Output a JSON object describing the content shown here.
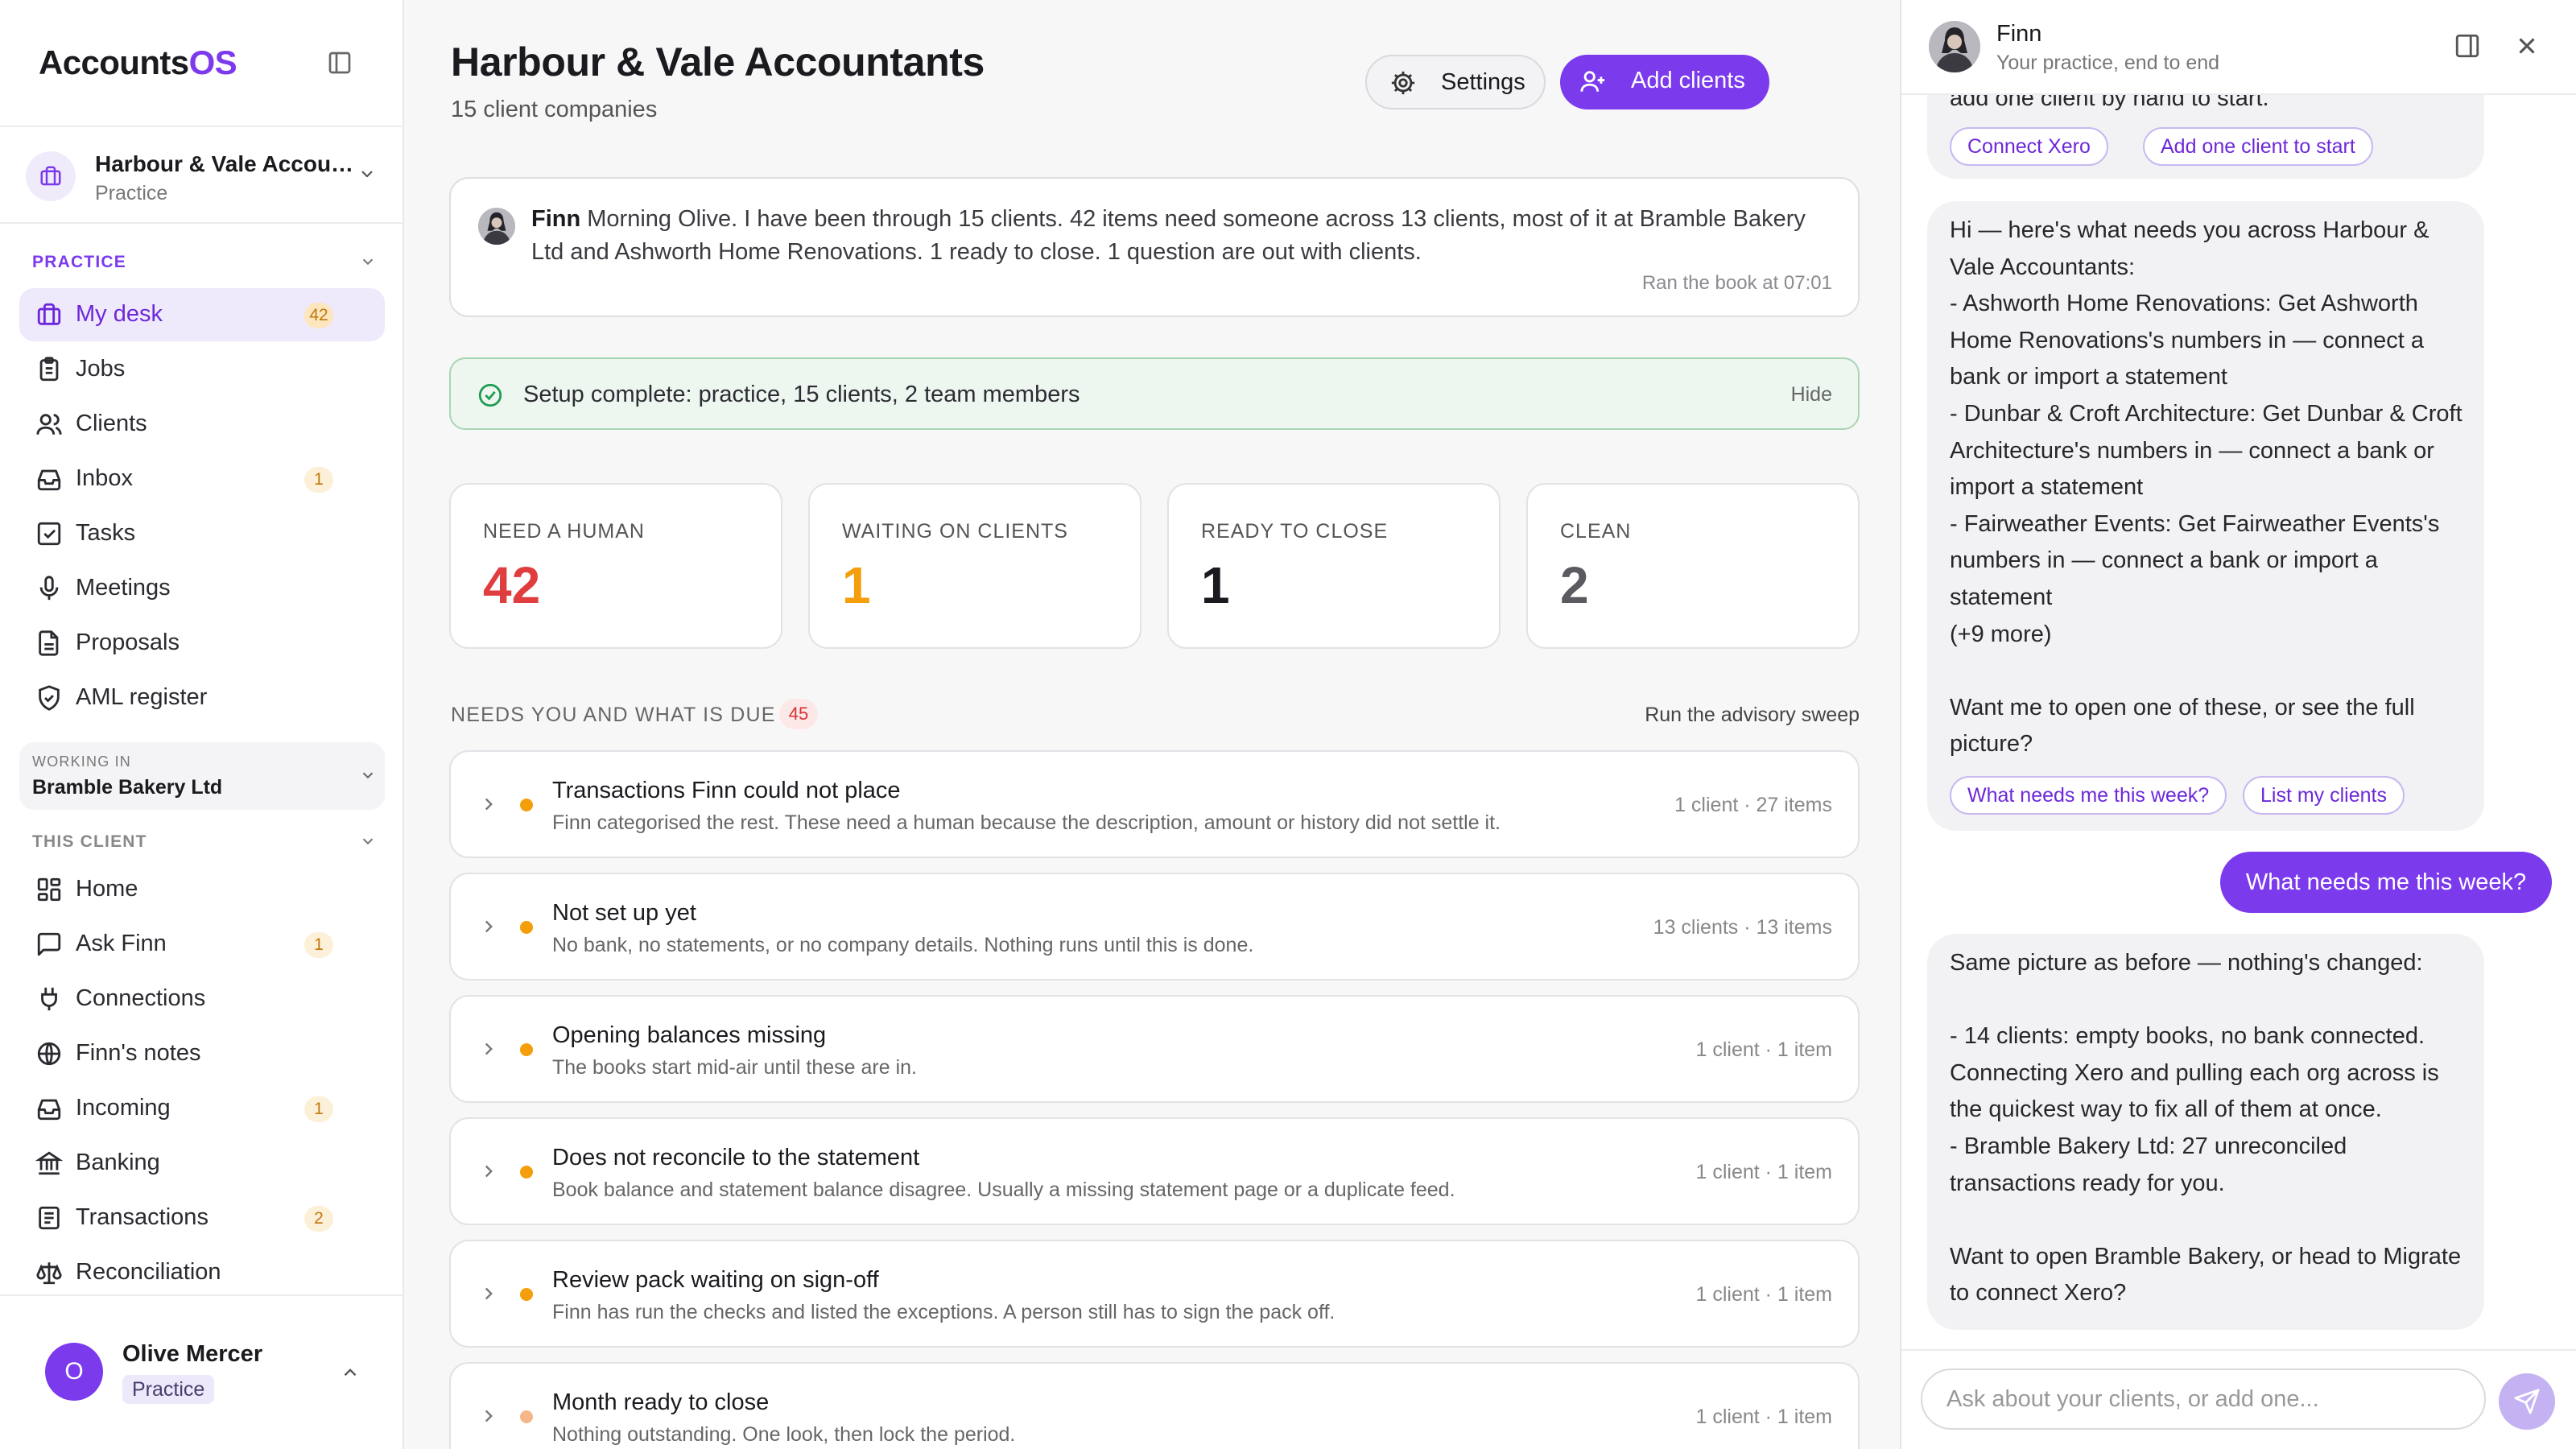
{
  "app": {
    "brand_prefix": "Accounts",
    "brand_suffix": "OS",
    "accent": "#7c3aed"
  },
  "org": {
    "name": "Harbour & Vale Accountants",
    "type": "Practice"
  },
  "sidebar": {
    "practice_label": "PRACTICE",
    "practice_items": [
      {
        "label": "My desk",
        "icon": "briefcase-icon",
        "badge": "42",
        "active": true
      },
      {
        "label": "Jobs",
        "icon": "clipboard-icon",
        "badge": ""
      },
      {
        "label": "Clients",
        "icon": "users-icon",
        "badge": ""
      },
      {
        "label": "Inbox",
        "icon": "inbox-icon",
        "badge": "1"
      },
      {
        "label": "Tasks",
        "icon": "checkbox-icon",
        "badge": ""
      },
      {
        "label": "Meetings",
        "icon": "microphone-icon",
        "badge": ""
      },
      {
        "label": "Proposals",
        "icon": "document-icon",
        "badge": ""
      },
      {
        "label": "AML register",
        "icon": "shield-check-icon",
        "badge": ""
      }
    ],
    "working_in_label": "WORKING IN",
    "working_in_value": "Bramble Bakery Ltd",
    "client_label": "THIS CLIENT",
    "client_items": [
      {
        "label": "Home",
        "icon": "grid-icon",
        "badge": ""
      },
      {
        "label": "Ask Finn",
        "icon": "chat-icon",
        "badge": "1"
      },
      {
        "label": "Connections",
        "icon": "plug-icon",
        "badge": ""
      },
      {
        "label": "Finn's notes",
        "icon": "globe-icon",
        "badge": ""
      },
      {
        "label": "Incoming",
        "icon": "inbox-icon",
        "badge": "1"
      },
      {
        "label": "Banking",
        "icon": "bank-icon",
        "badge": ""
      },
      {
        "label": "Transactions",
        "icon": "list-icon",
        "badge": "2"
      },
      {
        "label": "Reconciliation",
        "icon": "scale-icon",
        "badge": ""
      }
    ]
  },
  "user": {
    "initial": "O",
    "name": "Olive Mercer",
    "role": "Practice"
  },
  "header": {
    "title": "Harbour & Vale Accountants",
    "subtitle": "15 client companies",
    "settings_label": "Settings",
    "add_clients_label": "Add clients"
  },
  "briefing": {
    "author": "Finn",
    "text": "Morning Olive. I have been through 15 clients. 42 items need someone across 13 clients, most of it at Bramble Bakery Ltd and Ashworth Home Renovations. 1 ready to close. 1 question are out with clients.",
    "timestamp": "Ran the book at 07:01"
  },
  "setup": {
    "text": "Setup complete: practice, 15 clients, 2 team members",
    "hide_label": "Hide"
  },
  "stats": [
    {
      "label": "NEED A HUMAN",
      "value": "42",
      "color": "#e03e3e"
    },
    {
      "label": "WAITING ON CLIENTS",
      "value": "1",
      "color": "#f59e0b"
    },
    {
      "label": "READY TO CLOSE",
      "value": "1",
      "color": "#1a1a1f"
    },
    {
      "label": "CLEAN",
      "value": "2",
      "color": "#5a5a60"
    }
  ],
  "due": {
    "label": "NEEDS YOU AND WHAT IS DUE",
    "count": "45",
    "advisory_link": "Run the advisory sweep",
    "items": [
      {
        "title": "Transactions Finn could not place",
        "description": "Finn categorised the rest. These need a human because the description, amount or history did not settle it.",
        "meta": "1 client · 27 items",
        "dot_color": "#f59e0b"
      },
      {
        "title": "Not set up yet",
        "description": "No bank, no statements, or no company details. Nothing runs until this is done.",
        "meta": "13 clients · 13 items",
        "dot_color": "#f59e0b"
      },
      {
        "title": "Opening balances missing",
        "description": "The books start mid-air until these are in.",
        "meta": "1 client · 1 item",
        "dot_color": "#f59e0b"
      },
      {
        "title": "Does not reconcile to the statement",
        "description": "Book balance and statement balance disagree. Usually a missing statement page or a duplicate feed.",
        "meta": "1 client · 1 item",
        "dot_color": "#f59e0b"
      },
      {
        "title": "Review pack waiting on sign-off",
        "description": "Finn has run the checks and listed the exceptions. A person still has to sign the pack off.",
        "meta": "1 client · 1 item",
        "dot_color": "#f59e0b"
      },
      {
        "title": "Month ready to close",
        "description": "Nothing outstanding. One look, then lock the period.",
        "meta": "1 client · 1 item",
        "dot_color": "#f5b78a"
      }
    ]
  },
  "finn_panel": {
    "name": "Finn",
    "subtitle": "Your practice, end to end",
    "bubble1_text": "add one client by hand to start.",
    "bubble1_chips": [
      "Connect Xero",
      "Add one client to start"
    ],
    "bubble2_text": "Hi — here's what needs you across Harbour & Vale Accountants:\n- Ashworth Home Renovations: Get Ashworth Home Renovations's numbers in — connect a bank or import a statement\n- Dunbar & Croft Architecture: Get Dunbar & Croft Architecture's numbers in — connect a bank or import a statement\n- Fairweather Events: Get Fairweather Events's numbers in — connect a bank or import a statement\n(+9 more)\n\nWant me to open one of these, or see the full picture?",
    "bubble2_chips": [
      "What needs me this week?",
      "List my clients"
    ],
    "user_message": "What needs me this week?",
    "bubble3_text": "Same picture as before — nothing's changed:\n\n- 14 clients: empty books, no bank connected. Connecting Xero and pulling each org across is the quickest way to fix all of them at once.\n- Bramble Bakery Ltd: 27 unreconciled transactions ready for you.\n\nWant to open Bramble Bakery, or head to Migrate to connect Xero?",
    "input_placeholder": "Ask about your clients, or add one..."
  }
}
